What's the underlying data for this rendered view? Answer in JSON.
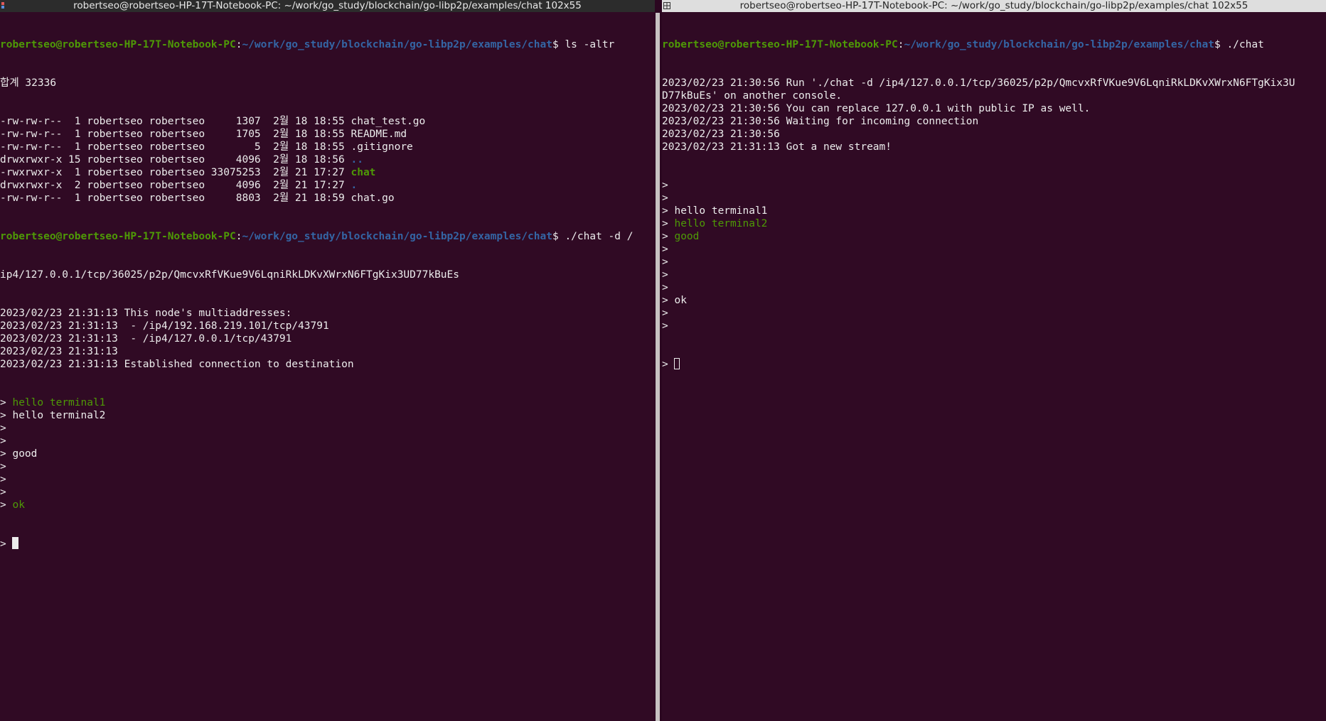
{
  "left": {
    "title": "robertseo@robertseo-HP-17T-Notebook-PC: ~/work/go_study/blockchain/go-libp2p/examples/chat 102x55",
    "prompt_user": "robertseo@robertseo-HP-17T-Notebook-PC",
    "prompt_path": "~/work/go_study/blockchain/go-libp2p/examples/chat",
    "prompt_sep": ":",
    "prompt_end": "$ ",
    "cmd1": "ls -altr",
    "total": "합계 32336",
    "ls_rows": [
      {
        "prefix": "-rw-rw-r--  1 robertseo robertseo     1307  2월 18 18:55 ",
        "name": "chat_test.go"
      },
      {
        "prefix": "-rw-rw-r--  1 robertseo robertseo     1705  2월 18 18:55 ",
        "name": "README.md"
      },
      {
        "prefix": "-rw-rw-r--  1 robertseo robertseo        5  2월 18 18:55 ",
        "name": ".gitignore"
      },
      {
        "prefix": "drwxrwxr-x 15 robertseo robertseo     4096  2월 18 18:56 ",
        "name": ".."
      },
      {
        "prefix": "-rwxrwxr-x  1 robertseo robertseo 33075253  2월 21 17:27 ",
        "name": "chat"
      },
      {
        "prefix": "drwxrwxr-x  2 robertseo robertseo     4096  2월 21 17:27 ",
        "name": "."
      },
      {
        "prefix": "-rw-rw-r--  1 robertseo robertseo     8803  2월 21 18:59 ",
        "name": "chat.go"
      }
    ],
    "cmd2": "./chat -d /",
    "cmd2_wrap": "ip4/127.0.0.1/tcp/36025/p2p/QmcvxRfVKue9V6LqniRkLDKvXWrxN6FTgKix3UD77kBuEs",
    "log": [
      "2023/02/23 21:31:13 This node's multiaddresses:",
      "2023/02/23 21:31:13  - /ip4/192.168.219.101/tcp/43791",
      "2023/02/23 21:31:13  - /ip4/127.0.0.1/tcp/43791",
      "2023/02/23 21:31:13",
      "2023/02/23 21:31:13 Established connection to destination"
    ],
    "chat": [
      {
        "text": "> ",
        "msg": "hello terminal1",
        "remote": true
      },
      {
        "text": "> ",
        "msg": "hello terminal2",
        "remote": false
      },
      {
        "text": ">",
        "msg": "",
        "remote": false
      },
      {
        "text": ">",
        "msg": "",
        "remote": false
      },
      {
        "text": "> ",
        "msg": "good",
        "remote": false
      },
      {
        "text": ">",
        "msg": "",
        "remote": false
      },
      {
        "text": ">",
        "msg": "",
        "remote": false
      },
      {
        "text": ">",
        "msg": "",
        "remote": false
      },
      {
        "text": "> ",
        "msg": "ok",
        "remote": true
      }
    ],
    "input_prompt": "> "
  },
  "right": {
    "title": "robertseo@robertseo-HP-17T-Notebook-PC: ~/work/go_study/blockchain/go-libp2p/examples/chat 102x55",
    "prompt_user": "robertseo@robertseo-HP-17T-Notebook-PC",
    "prompt_path": "~/work/go_study/blockchain/go-libp2p/examples/chat",
    "prompt_sep": ":",
    "prompt_end": "$ ",
    "cmd1": "./chat",
    "log": [
      "2023/02/23 21:30:56 Run './chat -d /ip4/127.0.0.1/tcp/36025/p2p/QmcvxRfVKue9V6LqniRkLDKvXWrxN6FTgKix3U",
      "D77kBuEs' on another console.",
      "2023/02/23 21:30:56 You can replace 127.0.0.1 with public IP as well.",
      "2023/02/23 21:30:56 Waiting for incoming connection",
      "2023/02/23 21:30:56",
      "2023/02/23 21:31:13 Got a new stream!"
    ],
    "chat": [
      {
        "text": ">",
        "msg": "",
        "remote": false
      },
      {
        "text": ">",
        "msg": "",
        "remote": false
      },
      {
        "text": "> ",
        "msg": "hello terminal1",
        "remote": false
      },
      {
        "text": "> ",
        "msg": "hello terminal2",
        "remote": true
      },
      {
        "text": "> ",
        "msg": "good",
        "remote": true
      },
      {
        "text": ">",
        "msg": "",
        "remote": false
      },
      {
        "text": ">",
        "msg": "",
        "remote": false
      },
      {
        "text": ">",
        "msg": "",
        "remote": false
      },
      {
        "text": ">",
        "msg": "",
        "remote": false
      },
      {
        "text": "> ",
        "msg": "ok",
        "remote": false
      },
      {
        "text": ">",
        "msg": "",
        "remote": false
      },
      {
        "text": ">",
        "msg": "",
        "remote": false
      }
    ],
    "input_prompt": "> "
  },
  "colors": {
    "background": "#300a24",
    "foreground": "#ececec",
    "green": "#4e9a06",
    "blue": "#3465a4"
  },
  "icons": {
    "left_title_icon": "terminal-split-icon",
    "right_title_icon": "grid-layout-icon"
  }
}
